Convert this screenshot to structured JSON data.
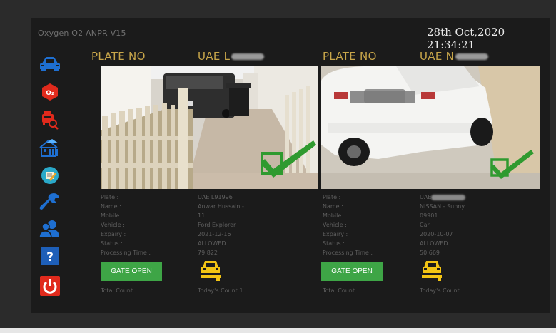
{
  "app": {
    "title": "Oxygen O2 ANPR V15",
    "datetime": "28th Oct,2020 21:34:21"
  },
  "sidebar": {
    "items": [
      {
        "icon": "car-icon",
        "color": "#1e6fd1"
      },
      {
        "icon": "o2-logo-icon",
        "label": "O₂",
        "color": "#e02a1c"
      },
      {
        "icon": "vehicle-search-icon",
        "color": "#e02a1c"
      },
      {
        "icon": "home-parking-icon",
        "color": "#1e6fd1"
      },
      {
        "icon": "note-edit-icon",
        "color": "#2aa9c9"
      },
      {
        "icon": "wrench-icon",
        "color": "#1e6fd1"
      },
      {
        "icon": "users-icon",
        "color": "#1e6fd1"
      },
      {
        "icon": "help-icon",
        "label": "?",
        "color": "#1e5fb8"
      },
      {
        "icon": "power-icon",
        "color": "#e02a1c"
      }
    ]
  },
  "lanes": [
    {
      "plate_header": "PLATE NO",
      "plate_prefix": "UAE L",
      "check_color": "#2f9a2f",
      "fields": {
        "plate_label": "Plate :",
        "plate": "UAE L91996",
        "name_label": "Name :",
        "name": "Anwar Hussain -",
        "mobile_label": "Mobile :",
        "mobile": "11",
        "vehicle_label": "Vehicle :",
        "vehicle": "Ford Explorer",
        "expiry_label": "Expairy :",
        "expiry": "2021-12-16",
        "status_label": "Status :",
        "status": "ALLOWED",
        "processing_label": "Processing Time :",
        "processing": "79.822"
      },
      "gate_button": "GATE OPEN",
      "total_count": "Total Count",
      "today_count": "Today's Count 1"
    },
    {
      "plate_header": "PLATE NO",
      "plate_prefix": "UAE N",
      "check_color": "#2f9a2f",
      "fields": {
        "plate_label": "Plate :",
        "plate": "UAE",
        "name_label": "Name :",
        "name": "NISSAN - Sunny",
        "mobile_label": "Mobile :",
        "mobile": "09901",
        "vehicle_label": "Vehicle :",
        "vehicle": "Car",
        "expiry_label": "Expairy :",
        "expiry": "2020-10-07",
        "status_label": "Status :",
        "status": "ALLOWED",
        "processing_label": "Processing Time :",
        "processing": "50.669"
      },
      "gate_button": "GATE OPEN",
      "total_count": "Total Count",
      "today_count": "Today's Count"
    }
  ],
  "colors": {
    "accent_gold": "#c8a64a",
    "gate_green": "#3ea546",
    "barrier_yellow": "#f2c414"
  }
}
